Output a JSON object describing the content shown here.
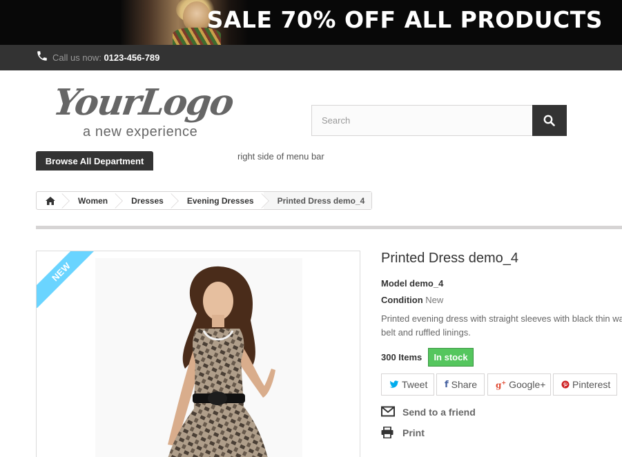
{
  "banner": {
    "text": "SALE 70% OFF ALL PRODUCTS"
  },
  "topbar": {
    "call_label": "Call us now:",
    "phone": "0123-456-789"
  },
  "logo": {
    "main": "YourLogo",
    "tagline": "a new experience"
  },
  "search": {
    "placeholder": "Search",
    "value": ""
  },
  "menu": {
    "browse_label": "Browse All Department",
    "right_text": "right side of menu bar"
  },
  "breadcrumb": {
    "items": [
      "Women",
      "Dresses",
      "Evening Dresses",
      "Printed Dress demo_4"
    ]
  },
  "product": {
    "ribbon": "NEW",
    "title": "Printed Dress demo_4",
    "model": "Model demo_4",
    "condition_label": "Condition",
    "condition_value": "New",
    "description": "Printed evening dress with straight sleeves with black thin wa belt and ruffled linings.",
    "quantity": "300 Items",
    "stock": "In stock"
  },
  "share": {
    "tweet": "Tweet",
    "share": "Share",
    "google": "Google+",
    "pinterest": "Pinterest"
  },
  "actions": {
    "send_friend": "Send to a friend",
    "print": "Print"
  },
  "colors": {
    "dark": "#333333",
    "stock_green": "#55c65e",
    "ribbon_blue": "#6ad4ff",
    "twitter": "#00aced",
    "facebook": "#435f9f",
    "google": "#e04b34",
    "pinterest": "#ce1f21"
  },
  "icons": [
    "phone-icon",
    "search-icon",
    "home-icon",
    "twitter-icon",
    "facebook-icon",
    "google-plus-icon",
    "pinterest-icon",
    "envelope-icon",
    "printer-icon"
  ]
}
